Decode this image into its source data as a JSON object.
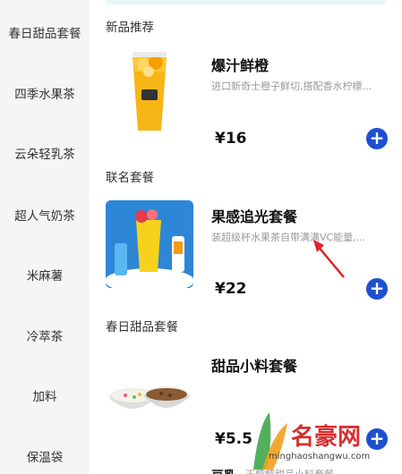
{
  "sidebar": {
    "items": [
      {
        "label": "春日甜品套餐"
      },
      {
        "label": "四季水果茶"
      },
      {
        "label": "云朵轻乳茶"
      },
      {
        "label": "超人气奶茶"
      },
      {
        "label": "米麻薯"
      },
      {
        "label": "冷萃茶"
      },
      {
        "label": "加料"
      },
      {
        "label": "保温袋"
      }
    ]
  },
  "sections": [
    {
      "title": "新品推荐",
      "product": {
        "name": "爆汁鲜橙",
        "desc": "进口新奇士橙子鲜切,搭配香水柠檬...",
        "price": "¥16",
        "add_label": "+",
        "image_icon": "orange-juice-cup-icon"
      }
    },
    {
      "title": "联名套餐",
      "product": {
        "name": "果感追光套餐",
        "desc": "装超级杯水果茶自带满满VC能量,...",
        "price": "¥22",
        "add_label": "+",
        "image_icon": "fruit-tea-sunscreen-combo-icon"
      }
    },
    {
      "title": "春日甜品套餐",
      "product": {
        "name": "甜品小料套餐",
        "desc": "",
        "price": "¥5.5",
        "add_label": "+",
        "image_icon": "dessert-bowls-icon"
      }
    }
  ],
  "partial_next": {
    "name": "豆乳",
    "desc": "王糯糯甜品小料套餐"
  },
  "watermark": {
    "name": "名豪网",
    "url": "minghaoshangwu.com"
  },
  "colors": {
    "accent": "#1d4fd1",
    "sidebar_bg": "#f5f5f5",
    "arrow": "#e0202a",
    "watermark_red": "#d43030"
  }
}
